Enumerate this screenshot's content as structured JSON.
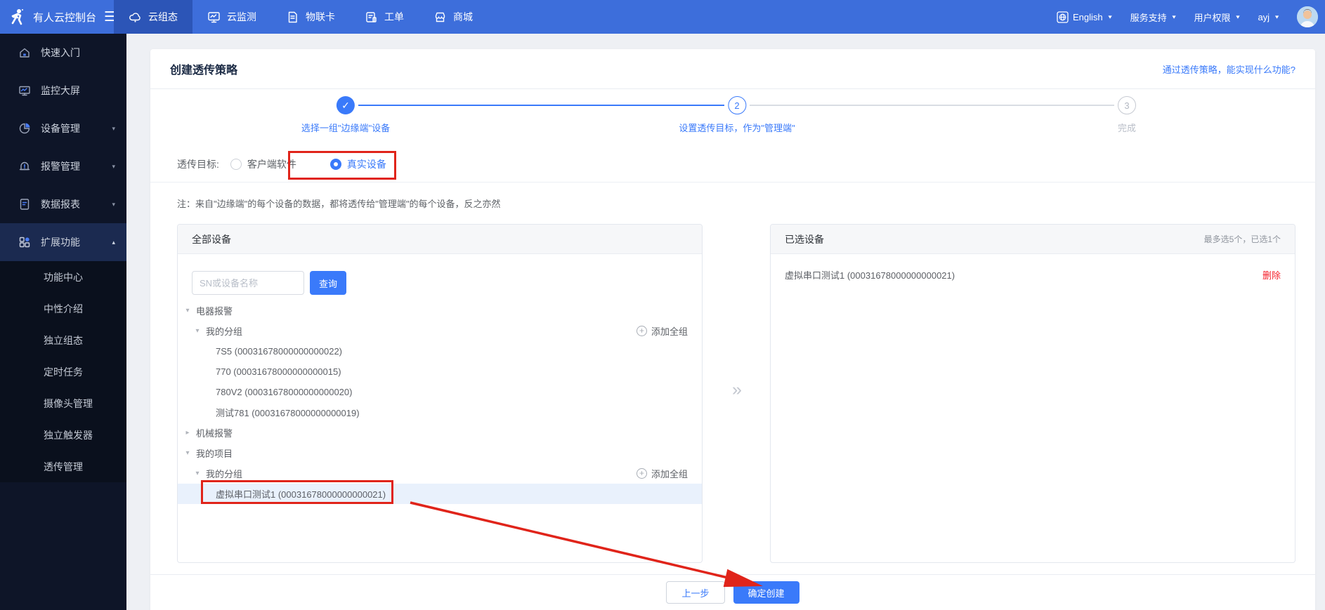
{
  "colors": {
    "navbar_blue": "#3d6edb",
    "navbar_active_tab": "#2c55b7",
    "sidebar_dark": "#0e1528",
    "accent_blue": "#3a7afa",
    "annotation_red": "#e0241a",
    "delete_red": "#f5222d",
    "selected_row_bg": "#e9f1fc"
  },
  "icons": {
    "hamburger": "☰",
    "caret_small": "▼",
    "chevron_down": "▾",
    "chevron_up": "▴",
    "caret_down": "▾",
    "caret_right": "▸",
    "check": "✓",
    "plus": "+",
    "double_chevron_right": "»"
  },
  "navbar": {
    "logo_title": "有人云控制台",
    "tabs": [
      {
        "label": "云组态",
        "icon": "cloud-icon",
        "active": true
      },
      {
        "label": "云监测",
        "icon": "monitor-icon",
        "active": false
      },
      {
        "label": "物联卡",
        "icon": "sim-card-icon",
        "active": false
      },
      {
        "label": "工单",
        "icon": "work-order-icon",
        "active": false
      },
      {
        "label": "商城",
        "icon": "store-icon",
        "active": false
      }
    ],
    "right": {
      "language": "English",
      "service_support": "服务支持",
      "user_permission": "用户权限",
      "username": "ayj"
    }
  },
  "sidebar": {
    "items": [
      {
        "label": "快速入门",
        "icon": "home-icon"
      },
      {
        "label": "监控大屏",
        "icon": "screen-icon"
      },
      {
        "label": "设备管理",
        "icon": "device-pie-icon",
        "expandable": true
      },
      {
        "label": "报警管理",
        "icon": "alarm-bell-icon",
        "expandable": true
      },
      {
        "label": "数据报表",
        "icon": "report-icon",
        "expandable": true
      },
      {
        "label": "扩展功能",
        "icon": "grid-icon",
        "expandable": true,
        "active": true,
        "expanded": true
      }
    ],
    "subitems": [
      {
        "label": "功能中心"
      },
      {
        "label": "中性介绍"
      },
      {
        "label": "独立组态"
      },
      {
        "label": "定时任务"
      },
      {
        "label": "摄像头管理"
      },
      {
        "label": "独立触发器"
      },
      {
        "label": "透传管理"
      }
    ]
  },
  "page": {
    "title": "创建透传策略",
    "help_link": "通过透传策略，能实现什么功能?",
    "steps": [
      {
        "label": "选择一组\"边缘端\"设备",
        "state": "done"
      },
      {
        "number": "2",
        "label": "设置透传目标，作为\"管理端\"",
        "state": "active"
      },
      {
        "number": "3",
        "label": "完成",
        "state": "pending"
      }
    ],
    "form": {
      "target_label": "透传目标:",
      "options": [
        {
          "label": "客户端软件",
          "selected": false
        },
        {
          "label": "真实设备",
          "selected": true
        }
      ],
      "note": "注：来自\"边缘端\"的每个设备的数据，都将透传给\"管理端\"的每个设备，反之亦然"
    },
    "all_devices": {
      "title": "全部设备",
      "search_placeholder": "SN或设备名称",
      "search_button": "查询",
      "tree": [
        {
          "label": "电器报警",
          "type": "group",
          "depth": 0,
          "caret": "down"
        },
        {
          "label": "我的分组",
          "type": "group",
          "depth": 1,
          "caret": "down",
          "action": "添加全组"
        },
        {
          "label": "7S5 (00031678000000000022)",
          "type": "device",
          "depth": 2
        },
        {
          "label": "770 (00031678000000000015)",
          "type": "device",
          "depth": 2
        },
        {
          "label": "780V2 (00031678000000000020)",
          "type": "device",
          "depth": 2
        },
        {
          "label": "测试781 (00031678000000000019)",
          "type": "device",
          "depth": 2
        },
        {
          "label": "机械报警",
          "type": "group",
          "depth": 0,
          "caret": "right"
        },
        {
          "label": "我的项目",
          "type": "group",
          "depth": 0,
          "caret": "down"
        },
        {
          "label": "我的分组",
          "type": "group",
          "depth": 1,
          "caret": "down",
          "action": "添加全组"
        },
        {
          "label": "虚拟串口测试1 (00031678000000000021)",
          "type": "device",
          "depth": 2,
          "selected": true
        }
      ]
    },
    "selected_panel": {
      "title": "已选设备",
      "limit": "最多选5个，已选1个",
      "items": [
        {
          "label": "虚拟串口测试1 (00031678000000000021)",
          "action": "删除"
        }
      ]
    },
    "footer": {
      "prev": "上一步",
      "submit": "确定创建"
    }
  }
}
